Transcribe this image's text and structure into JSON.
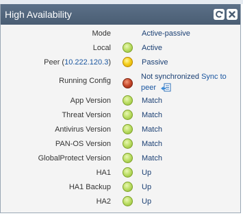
{
  "panel": {
    "title": "High Availability",
    "icons": [
      "refresh-icon",
      "close-icon"
    ]
  },
  "rows": [
    {
      "label": "Mode",
      "value": "Active-passive",
      "status": null
    },
    {
      "label": "Local",
      "value": "Active",
      "status": "green"
    },
    {
      "label_prefix": "Peer (",
      "label_link": "10.222.120.3",
      "label_suffix": ")",
      "value": "Passive",
      "status": "yellow"
    },
    {
      "label": "Running Config",
      "value": "Not synchronized",
      "action_link": "Sync to peer",
      "status": "red"
    },
    {
      "label": "App Version",
      "value": "Match",
      "status": "green"
    },
    {
      "label": "Threat Version",
      "value": "Match",
      "status": "green"
    },
    {
      "label": "Antivirus Version",
      "value": "Match",
      "status": "green"
    },
    {
      "label": "PAN-OS Version",
      "value": "Match",
      "status": "green"
    },
    {
      "label": "GlobalProtect Version",
      "value": "Match",
      "status": "green"
    },
    {
      "label": "HA1",
      "value": "Up",
      "status": "green"
    },
    {
      "label": "HA1 Backup",
      "value": "Up",
      "status": "green"
    },
    {
      "label": "HA2",
      "value": "Up",
      "status": "green"
    }
  ],
  "colors": {
    "header_bg": "#4f637a",
    "link": "#1a56a0",
    "value_text": "#1a3f73",
    "status_green": "#a9cf45",
    "status_yellow": "#f0c419",
    "status_red": "#b8432a"
  }
}
